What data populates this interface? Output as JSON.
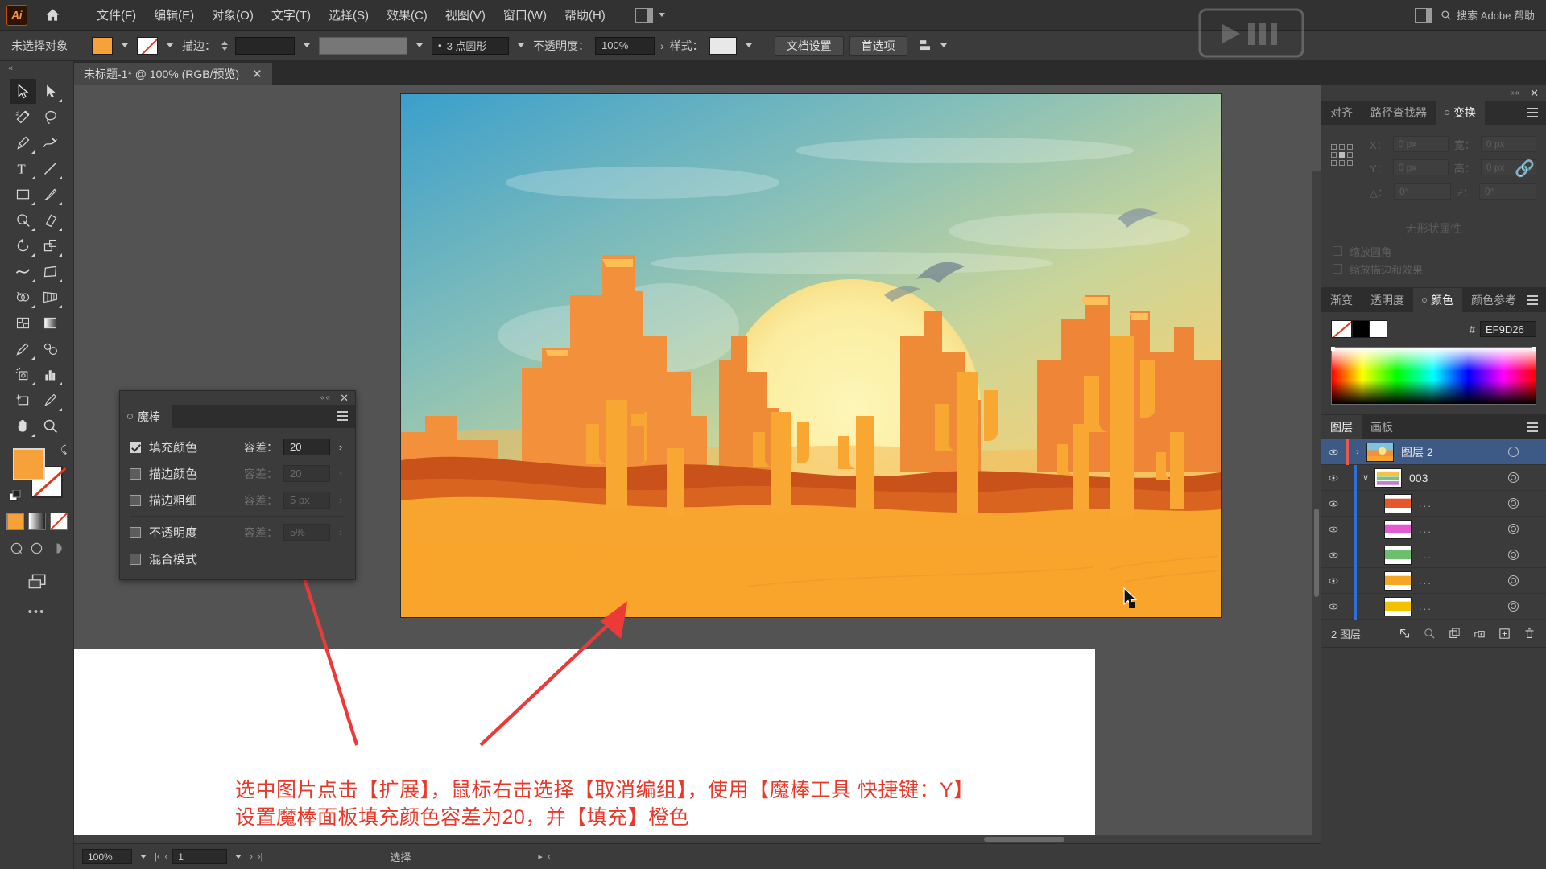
{
  "app": {
    "logo_text": "Ai",
    "home_icon": "home-icon",
    "search_placeholder": "搜索 Adobe 帮助"
  },
  "menubar": {
    "items": [
      {
        "label": "文件(F)"
      },
      {
        "label": "编辑(E)"
      },
      {
        "label": "对象(O)"
      },
      {
        "label": "文字(T)"
      },
      {
        "label": "选择(S)"
      },
      {
        "label": "效果(C)"
      },
      {
        "label": "视图(V)"
      },
      {
        "label": "窗口(W)"
      },
      {
        "label": "帮助(H)"
      }
    ]
  },
  "controlbar": {
    "selection_status": "未选择对象",
    "stroke_label": "描边：",
    "stroke_weight": "",
    "stroke_profile": "",
    "brush_def": "3 点圆形",
    "opacity_label": "不透明度：",
    "opacity_value": "100%",
    "style_label": "样式：",
    "doc_setup_btn": "文档设置",
    "preferences_btn": "首选项"
  },
  "document": {
    "tab_title": "未标题-1* @ 100% (RGB/预览)",
    "close_icon": "close-icon"
  },
  "toolbar": {
    "tools": [
      "selection-tool",
      "direct-selection-tool",
      "magic-wand-tool",
      "lasso-tool",
      "pen-tool",
      "curvature-tool",
      "type-tool",
      "line-tool",
      "rectangle-tool",
      "paintbrush-tool",
      "shaper-tool",
      "eraser-tool",
      "rotate-tool",
      "scale-tool",
      "width-tool",
      "free-transform-tool",
      "shape-builder-tool",
      "perspective-grid-tool",
      "mesh-tool",
      "gradient-tool",
      "eyedropper-tool",
      "blend-tool",
      "symbol-sprayer-tool",
      "column-graph-tool",
      "artboard-tool",
      "slice-tool",
      "hand-tool",
      "zoom-tool"
    ],
    "fill_color": "#F7A13A",
    "stroke_color": "#FFFFFF",
    "more_icon": "more-options-icon"
  },
  "magic_wand_panel": {
    "title": "魔棒",
    "close_icon": "close-icon",
    "menu_icon": "panel-menu-icon",
    "rows": [
      {
        "label": "填充颜色",
        "checked": true,
        "tolerance_label": "容差：",
        "tolerance_value": "20",
        "enabled": true
      },
      {
        "label": "描边颜色",
        "checked": false,
        "tolerance_label": "容差：",
        "tolerance_value": "20",
        "enabled": false
      },
      {
        "label": "描边粗细",
        "checked": false,
        "tolerance_label": "容差：",
        "tolerance_value": "5 px",
        "enabled": false
      },
      {
        "label": "不透明度",
        "checked": false,
        "tolerance_label": "容差：",
        "tolerance_value": "5%",
        "enabled": false
      },
      {
        "label": "混合模式",
        "checked": false,
        "tolerance_label": "",
        "tolerance_value": "",
        "enabled": false
      }
    ]
  },
  "transform_panel": {
    "tabs": [
      {
        "label": "对齐",
        "active": false
      },
      {
        "label": "路径查找器",
        "active": false
      },
      {
        "label": "变换",
        "active": true
      }
    ],
    "fields": {
      "x_label": "X：",
      "x_value": "0 px",
      "y_label": "Y：",
      "y_value": "0 px",
      "w_label": "宽：",
      "w_value": "0 px",
      "h_label": "高：",
      "h_value": "0 px",
      "angle_label": "△：",
      "angle_value": "0°",
      "shear_label": "⌿：",
      "shear_value": "0°"
    },
    "note": "无形状属性",
    "checks": [
      {
        "label": "缩放圆角"
      },
      {
        "label": "缩放描边和效果"
      }
    ],
    "link_icon": "constrain-proportions-icon"
  },
  "color_panel": {
    "tabs": [
      {
        "label": "渐变",
        "active": false
      },
      {
        "label": "透明度",
        "active": false
      },
      {
        "label": "颜色",
        "active": true
      },
      {
        "label": "颜色参考",
        "active": false
      }
    ],
    "hash_symbol": "#",
    "hex_value": "EF9D26",
    "none_swatch": "none-color-swatch",
    "black_swatch": "#000000",
    "white_swatch": "#FFFFFF"
  },
  "layers_panel": {
    "tabs": [
      {
        "label": "图层",
        "active": true
      },
      {
        "label": "画板",
        "active": false
      }
    ],
    "rows": [
      {
        "name": "图层 2",
        "selected": true,
        "indent": 0,
        "color": "#e85a4f",
        "thumb": "sunset",
        "expand": "collapsed",
        "eye": "visible"
      },
      {
        "name": "003",
        "selected": false,
        "indent": 1,
        "color": "#2f6fd8",
        "thumb": "art",
        "expand": "expanded",
        "eye": "visible"
      },
      {
        "name": "...",
        "selected": false,
        "indent": 2,
        "color": "#2f6fd8",
        "thumb": "red",
        "expand": "none",
        "eye": "visible"
      },
      {
        "name": "...",
        "selected": false,
        "indent": 2,
        "color": "#2f6fd8",
        "thumb": "magenta",
        "expand": "none",
        "eye": "visible"
      },
      {
        "name": "...",
        "selected": false,
        "indent": 2,
        "color": "#2f6fd8",
        "thumb": "green",
        "expand": "none",
        "eye": "visible"
      },
      {
        "name": "...",
        "selected": false,
        "indent": 2,
        "color": "#2f6fd8",
        "thumb": "orange",
        "expand": "none",
        "eye": "visible"
      },
      {
        "name": "...",
        "selected": false,
        "indent": 2,
        "color": "#2f6fd8",
        "thumb": "yellow",
        "expand": "none",
        "eye": "visible"
      }
    ],
    "footer_count": "2 图层",
    "footer_icons": [
      "locate-object-icon",
      "search-layers-icon",
      "new-sublayer-icon",
      "new-layer-icon",
      "duplicate-icon",
      "delete-layer-icon"
    ]
  },
  "statusbar": {
    "zoom_value": "100%",
    "page_value": "1",
    "status_text": "选择",
    "first_icon": "first-page-icon",
    "prev_icon": "prev-page-icon",
    "next_icon": "next-page-icon",
    "last_icon": "last-page-icon"
  },
  "annotation": {
    "line1": "选中图片点击【扩展】，鼠标右击选择【取消编组】，使用【魔棒工具 快捷键：Y】",
    "line2": "设置魔棒面板填充颜色容差为20，并【填充】橙色",
    "color": "#E8392A",
    "arrow_count": 2
  },
  "artwork": {
    "title": "desert-sunset-illustration",
    "sky_top": "#3aa0cc",
    "sky_mid": "#9dc9b4",
    "sky_warm": "#f3d67a",
    "sun_color": "#fbf0a8",
    "mesa_light": "#f5913c",
    "mesa_dark": "#d95f1e",
    "dune_dark": "#c24d12",
    "foreground": "#f9a52c",
    "cactus": "#f8a832",
    "bird_color": "#8a9aa0"
  }
}
